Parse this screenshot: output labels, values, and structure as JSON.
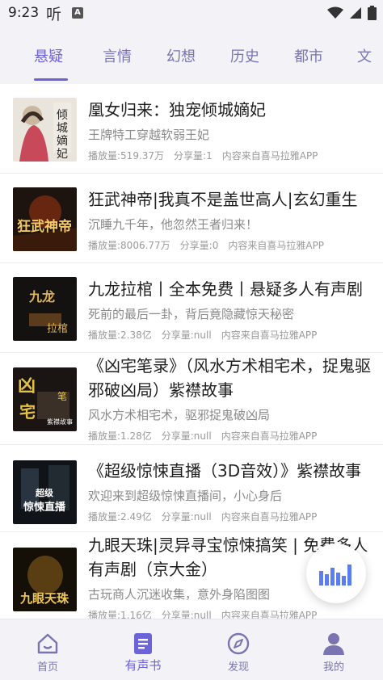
{
  "status": {
    "time": "9:23",
    "ting": "听",
    "a_badge": "A"
  },
  "tabs": [
    {
      "label": "悬疑",
      "active": true
    },
    {
      "label": "言情",
      "active": false
    },
    {
      "label": "幻想",
      "active": false
    },
    {
      "label": "历史",
      "active": false
    },
    {
      "label": "都市",
      "active": false
    },
    {
      "label": "文",
      "active": false
    }
  ],
  "items": [
    {
      "title": "凰女归来：独宠倾城嫡妃",
      "desc": "王牌特工穿越软弱王妃",
      "plays": "播放量:519.37万",
      "shares": "分享量:1",
      "source": "内容来自喜马拉雅APP",
      "cover_text": "倾城嫡妃"
    },
    {
      "title": "狂武神帝|我真不是盖世高人|玄幻重生",
      "desc": "沉睡九千年，他忽然王者归来！",
      "plays": "播放量:8006.77万",
      "shares": "分享量:0",
      "source": "内容来自喜马拉雅APP",
      "cover_text": "狂武神帝"
    },
    {
      "title": "九龙拉棺丨全本免费丨悬疑多人有声剧",
      "desc": "死前的最后一卦，背后竟隐藏惊天秘密",
      "plays": "播放量:2.38亿",
      "shares": "分享量:null",
      "source": "内容来自喜马拉雅APP",
      "cover_text": "九龙拉棺"
    },
    {
      "title": "《凶宅笔录》（风水方术相宅术，捉鬼驱邪破凶局）紫襟故事",
      "desc": "风水方术相宅术，驱邪捉鬼破凶局",
      "plays": "播放量:1.28亿",
      "shares": "分享量:null",
      "source": "内容来自喜马拉雅APP",
      "cover_text": "凶宅笔录"
    },
    {
      "title": "《超级惊悚直播（3D音效）》紫襟故事",
      "desc": "欢迎来到超级惊悚直播间，小心身后",
      "plays": "播放量:2.49亿",
      "shares": "分享量:null",
      "source": "内容来自喜马拉雅APP",
      "cover_text": "超级惊悚直播"
    },
    {
      "title": "九眼天珠|灵异寻宝惊悚搞笑 | 免费多人有声剧（京大金）",
      "desc": "古玩商人沉迷收集，意外身陷图图",
      "plays": "播放量:1.16亿",
      "shares": "分享量:null",
      "source": "内容来自喜马拉雅APP",
      "cover_text": "九眼天珠"
    }
  ],
  "nav": [
    {
      "label": "首页",
      "icon": "home-icon",
      "active": false
    },
    {
      "label": "有声书",
      "icon": "audiobook-icon",
      "active": true
    },
    {
      "label": "发现",
      "icon": "compass-icon",
      "active": false
    },
    {
      "label": "我的",
      "icon": "person-icon",
      "active": false
    }
  ],
  "colors": {
    "accent": "#6d63d8",
    "tab_inactive": "#7a74b0",
    "background": "#f3f2f7"
  }
}
